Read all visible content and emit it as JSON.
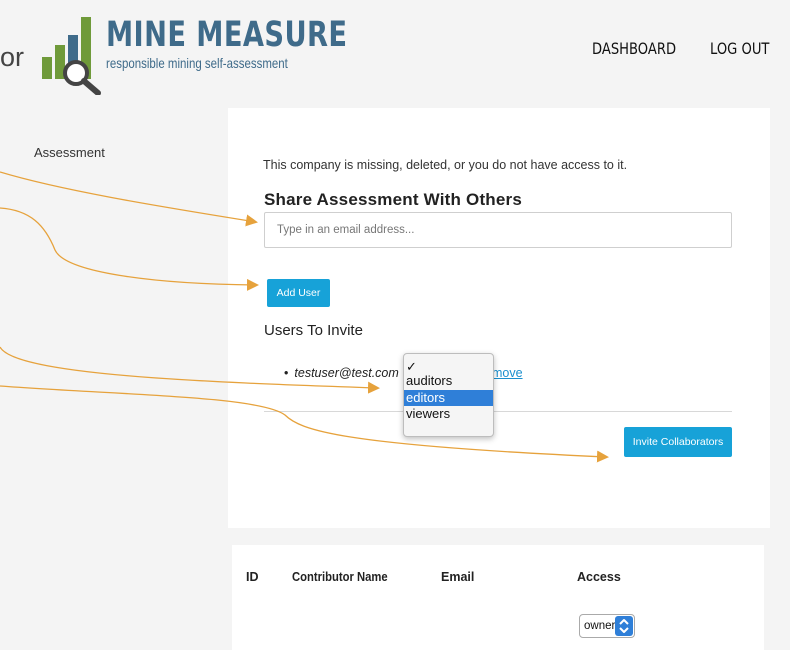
{
  "header": {
    "partial_text": "or",
    "logo_title": "MINE MEASURE",
    "logo_subtitle": "responsible mining self-assessment",
    "nav": {
      "dashboard": "DASHBOARD",
      "logout": "LOG OUT"
    }
  },
  "sidebar": {
    "label": "Assessment"
  },
  "share": {
    "message": "This company is missing, deleted, or you do not have access to it.",
    "title": "Share Assessment With Others",
    "email_placeholder": "Type in an email address...",
    "add_user_label": "Add User",
    "users_to_invite_heading": "Users To Invite",
    "invitees": [
      {
        "bullet": "•",
        "email": "testuser@test.com",
        "remove_label": "Remove"
      }
    ],
    "invite_button_label": "Invite Collaborators"
  },
  "role_dropdown": {
    "checkmark": "✓",
    "options": [
      "auditors",
      "editors",
      "viewers"
    ],
    "highlighted": "editors"
  },
  "contributors_table": {
    "headers": {
      "id": "ID",
      "name": "Contributor Name",
      "email": "Email",
      "access": "Access"
    },
    "rows": [
      {
        "access": "owner"
      }
    ]
  },
  "colors": {
    "accent_blue": "#17a2d8",
    "logo_blue": "#3f6b8a",
    "logo_green": "#6f9a3a",
    "annotation_orange": "#e6a23c",
    "selection_blue": "#2f7fd8"
  }
}
